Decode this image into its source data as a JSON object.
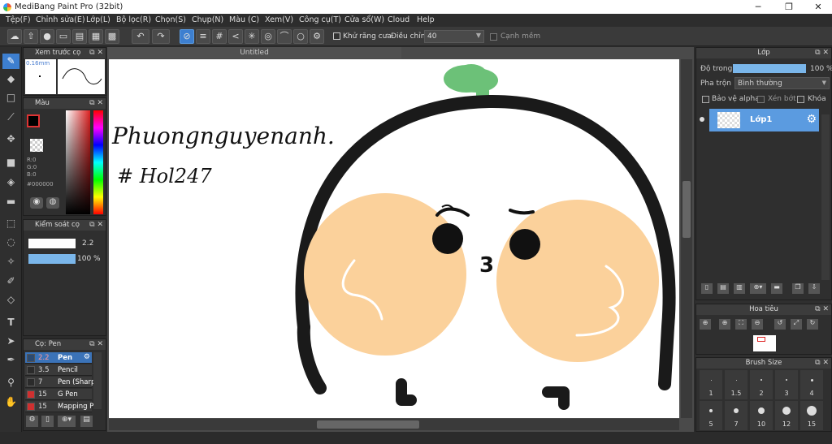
{
  "app": {
    "title": "MediBang Paint Pro (32bit)",
    "minimize": "─",
    "maximize": "❐",
    "close": "✕"
  },
  "menu": [
    "Tệp(F)",
    "Chỉnh sửa(E)",
    "Lớp(L)",
    "Bộ lọc(R)",
    "Chọn(S)",
    "Chụp(N)",
    "Màu (C)",
    "Xem(V)",
    "Công cụ(T)",
    "Cửa sổ(W)",
    "Cloud",
    "Help"
  ],
  "toolbar": {
    "antialias_label": "Khử răng cưa",
    "adjust_label": "Điều chỉnh",
    "adjust_value": "40",
    "smooth_label": "Cạnh mềm"
  },
  "brush_preview": {
    "title": "Xem trước cọ",
    "size": "0.16mm"
  },
  "color_panel": {
    "title": "Màu",
    "r": "R:0",
    "g": "G:0",
    "b": "B:0",
    "hex": "#000000",
    "primary": "#000000",
    "secondary": "#ffffff"
  },
  "brush_control": {
    "title": "Kiểm soát cọ",
    "size": "2.2",
    "opacity": "100 %"
  },
  "brush_list": {
    "title": "Cọ: Pen",
    "items": [
      {
        "size": "2.2",
        "name": "Pen",
        "color": "#2c4a70",
        "selected": true
      },
      {
        "size": "3.5",
        "name": "Pencil",
        "color": "#2b2b2b",
        "selected": false
      },
      {
        "size": "7",
        "name": "Pen (Sharp",
        "color": "#2b2b2b",
        "selected": false
      },
      {
        "size": "15",
        "name": "G Pen",
        "color": "#d03030",
        "selected": false
      },
      {
        "size": "15",
        "name": "Mapping P",
        "color": "#d03030",
        "selected": false
      }
    ]
  },
  "canvas": {
    "tab": "Untitled",
    "handwriting_line1": "Phuongnguyenanh.",
    "handwriting_line2": "# Hol247",
    "mouth": "3"
  },
  "layer_panel": {
    "title": "Lớp",
    "opacity_label": "Độ trong",
    "opacity_value": "100 %",
    "blend_label": "Pha trộn",
    "blend_value": "Bình thường",
    "protect_alpha": "Bảo vệ alpha",
    "clip": "Xén bớt",
    "lock": "Khóa",
    "layer_name": "Lớp1"
  },
  "navigator": {
    "title": "Hoa tiêu"
  },
  "brush_size": {
    "title": "Brush Size",
    "row1": [
      "1",
      "1.5",
      "2",
      "3",
      "4"
    ],
    "row2": [
      "5",
      "7",
      "10",
      "12",
      "15"
    ]
  }
}
